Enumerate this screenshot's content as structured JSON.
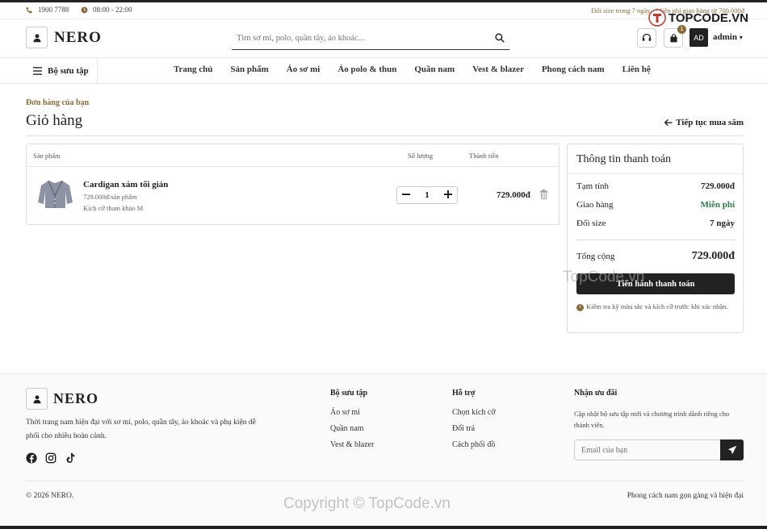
{
  "topbar": {
    "phone": "1900 7788",
    "hours": "08:00 - 22:00",
    "promo": "Đổi size trong 7 ngày · Miễn phí giao hàng từ 700.000đ"
  },
  "brand": {
    "name": "NERO"
  },
  "search": {
    "placeholder": "Tìm sơ mi, polo, quần tây, áo khoác..."
  },
  "header": {
    "cart_count": "1",
    "avatar_initials": "AD",
    "username": "admin"
  },
  "nav": {
    "collection_label": "Bộ sưu tập",
    "links": [
      "Trang chủ",
      "Sản phẩm",
      "Áo sơ mi",
      "Áo polo & thun",
      "Quần nam",
      "Vest & blazer",
      "Phong cách nam",
      "Liên hệ"
    ]
  },
  "page": {
    "eyebrow": "Đơn hàng của bạn",
    "title": "Giỏ hàng",
    "continue_label": "Tiếp tục mua sắm"
  },
  "cart": {
    "headers": {
      "product": "Sản phẩm",
      "quantity": "Số lượng",
      "total": "Thành tiền"
    },
    "items": [
      {
        "name": "Cardigan xám tối giản",
        "unit_price": "729.000đ/sản phẩm",
        "size_note": "Kích cỡ tham khảo M",
        "quantity": "1",
        "line_total": "729.000đ"
      }
    ]
  },
  "summary": {
    "title": "Thông tin thanh toán",
    "rows": [
      {
        "label": "Tạm tính",
        "value": "729.000đ"
      },
      {
        "label": "Giao hàng",
        "value": "Miễn phí"
      },
      {
        "label": "Đổi size",
        "value": "7 ngày"
      }
    ],
    "total_label": "Tổng cộng",
    "total_value": "729.000đ",
    "checkout_label": "Tiến hành thanh toán",
    "note": "Kiểm tra kỹ màu sắc và kích cỡ trước khi xác nhận."
  },
  "footer": {
    "description": "Thời trang nam hiện đại với sơ mi, polo, quần tây, áo khoác và phụ kiện dễ phối cho nhiều hoàn cảnh.",
    "col1": {
      "title": "Bộ sưu tập",
      "links": [
        "Áo sơ mi",
        "Quần nam",
        "Vest & blazer"
      ]
    },
    "col2": {
      "title": "Hỗ trợ",
      "links": [
        "Chọn kích cỡ",
        "Đổi trả",
        "Cách phối đồ"
      ]
    },
    "newsletter": {
      "title": "Nhận ưu đãi",
      "text": "Cập nhật bộ sưu tập mới và chương trình dành riêng cho thành viên.",
      "placeholder": "Email của bạn"
    },
    "copyright": "© 2026 NERO.",
    "tagline": "Phong cách nam gọn gàng và hiện đại"
  },
  "watermarks": {
    "logo": "TOPCODE.VN",
    "center": "TopCode.vn",
    "bottom": "Copyright © TopCode.vn"
  }
}
